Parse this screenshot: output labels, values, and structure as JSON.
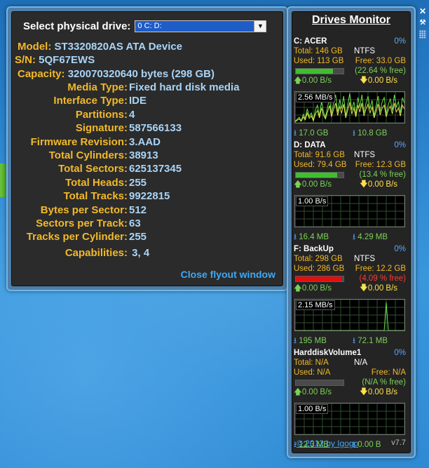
{
  "flyout": {
    "select_label": "Select physical drive:",
    "selected_drive": "0 C: D:",
    "model_label": "Model:",
    "model_value": "ST3320820AS ATA Device",
    "sn_label": "S/N:",
    "sn_value": "5QF67EWS",
    "capacity_label": "Capacity:",
    "capacity_value": "320070320640 bytes (298 GB)",
    "rows": [
      {
        "k": "Media Type:",
        "v": "Fixed hard disk media"
      },
      {
        "k": "Interface Type:",
        "v": "IDE"
      },
      {
        "k": "Partitions:",
        "v": "4"
      },
      {
        "k": "Signature:",
        "v": "587566133"
      },
      {
        "k": "Firmware Revision:",
        "v": "3.AAD"
      },
      {
        "k": "Total Cylinders:",
        "v": "38913"
      },
      {
        "k": "Total Sectors:",
        "v": "625137345"
      },
      {
        "k": "Total Heads:",
        "v": "255"
      },
      {
        "k": "Total Tracks:",
        "v": "9922815"
      },
      {
        "k": "Bytes per Sector:",
        "v": "512"
      },
      {
        "k": "Sectors per Track:",
        "v": "63"
      },
      {
        "k": "Tracks per Cylinder:",
        "v": "255"
      }
    ],
    "capabilities_label": "Capabilities:",
    "capabilities_value": "3, 4",
    "close_label": "Close flyout window"
  },
  "gadget": {
    "title": "Drives Monitor",
    "drives": [
      {
        "name": "C: ACER",
        "pct": "0%",
        "total": "Total: 146 GB",
        "fs": "NTFS",
        "used": "Used: 113 GB",
        "free": "Free: 33.0 GB",
        "free_pct": "(22.64 % free)",
        "free_pct_color": "#7cd157",
        "bar_fill": 0.7736,
        "bar_color": "#3fbf2f",
        "up_rate": "0.00 B/s",
        "down_rate": "0.00 B/s",
        "graph_label": "2.56 MB/s",
        "total_up": "17.0 GB",
        "total_down": "10.8 GB"
      },
      {
        "name": "D: DATA",
        "pct": "0%",
        "total": "Total: 91.6 GB",
        "fs": "NTFS",
        "used": "Used: 79.4 GB",
        "free": "Free: 12.3 GB",
        "free_pct": "(13.4 % free)",
        "free_pct_color": "#7cd157",
        "bar_fill": 0.866,
        "bar_color": "#3fbf2f",
        "up_rate": "0.00 B/s",
        "down_rate": "0.00 B/s",
        "graph_label": "1.00 B/s",
        "total_up": "16.4 MB",
        "total_down": "4.29 MB"
      },
      {
        "name": "F: BackUp",
        "pct": "0%",
        "total": "Total: 298 GB",
        "fs": "NTFS",
        "used": "Used: 286 GB",
        "free": "Free: 12.2 GB",
        "free_pct": "(4.09 % free)",
        "free_pct_color": "#ff3b30",
        "bar_fill": 0.959,
        "bar_color": "#e01010",
        "up_rate": "0.00 B/s",
        "down_rate": "0.00 B/s",
        "graph_label": "2.15 MB/s",
        "total_up": "195 MB",
        "total_down": "72.1 MB"
      },
      {
        "name": "HarddiskVolume1",
        "pct": "0%",
        "total": "Total: N/A",
        "fs": "N/A",
        "used": "Used: N/A",
        "free": "Free: N/A",
        "free_pct": "(N/A % free)",
        "free_pct_color": "#7cd157",
        "bar_fill": 0,
        "bar_color": "#3fbf2f",
        "up_rate": "0.00 B/s",
        "down_rate": "0.00 B/s",
        "graph_label": "1.00 B/s",
        "total_up": "12.3 MB",
        "total_down": "0.00 B"
      }
    ],
    "copyright": "© 2012 by Igogo",
    "version": "v7.7"
  },
  "side_buttons": {
    "close": "✕",
    "settings": "🔧"
  }
}
